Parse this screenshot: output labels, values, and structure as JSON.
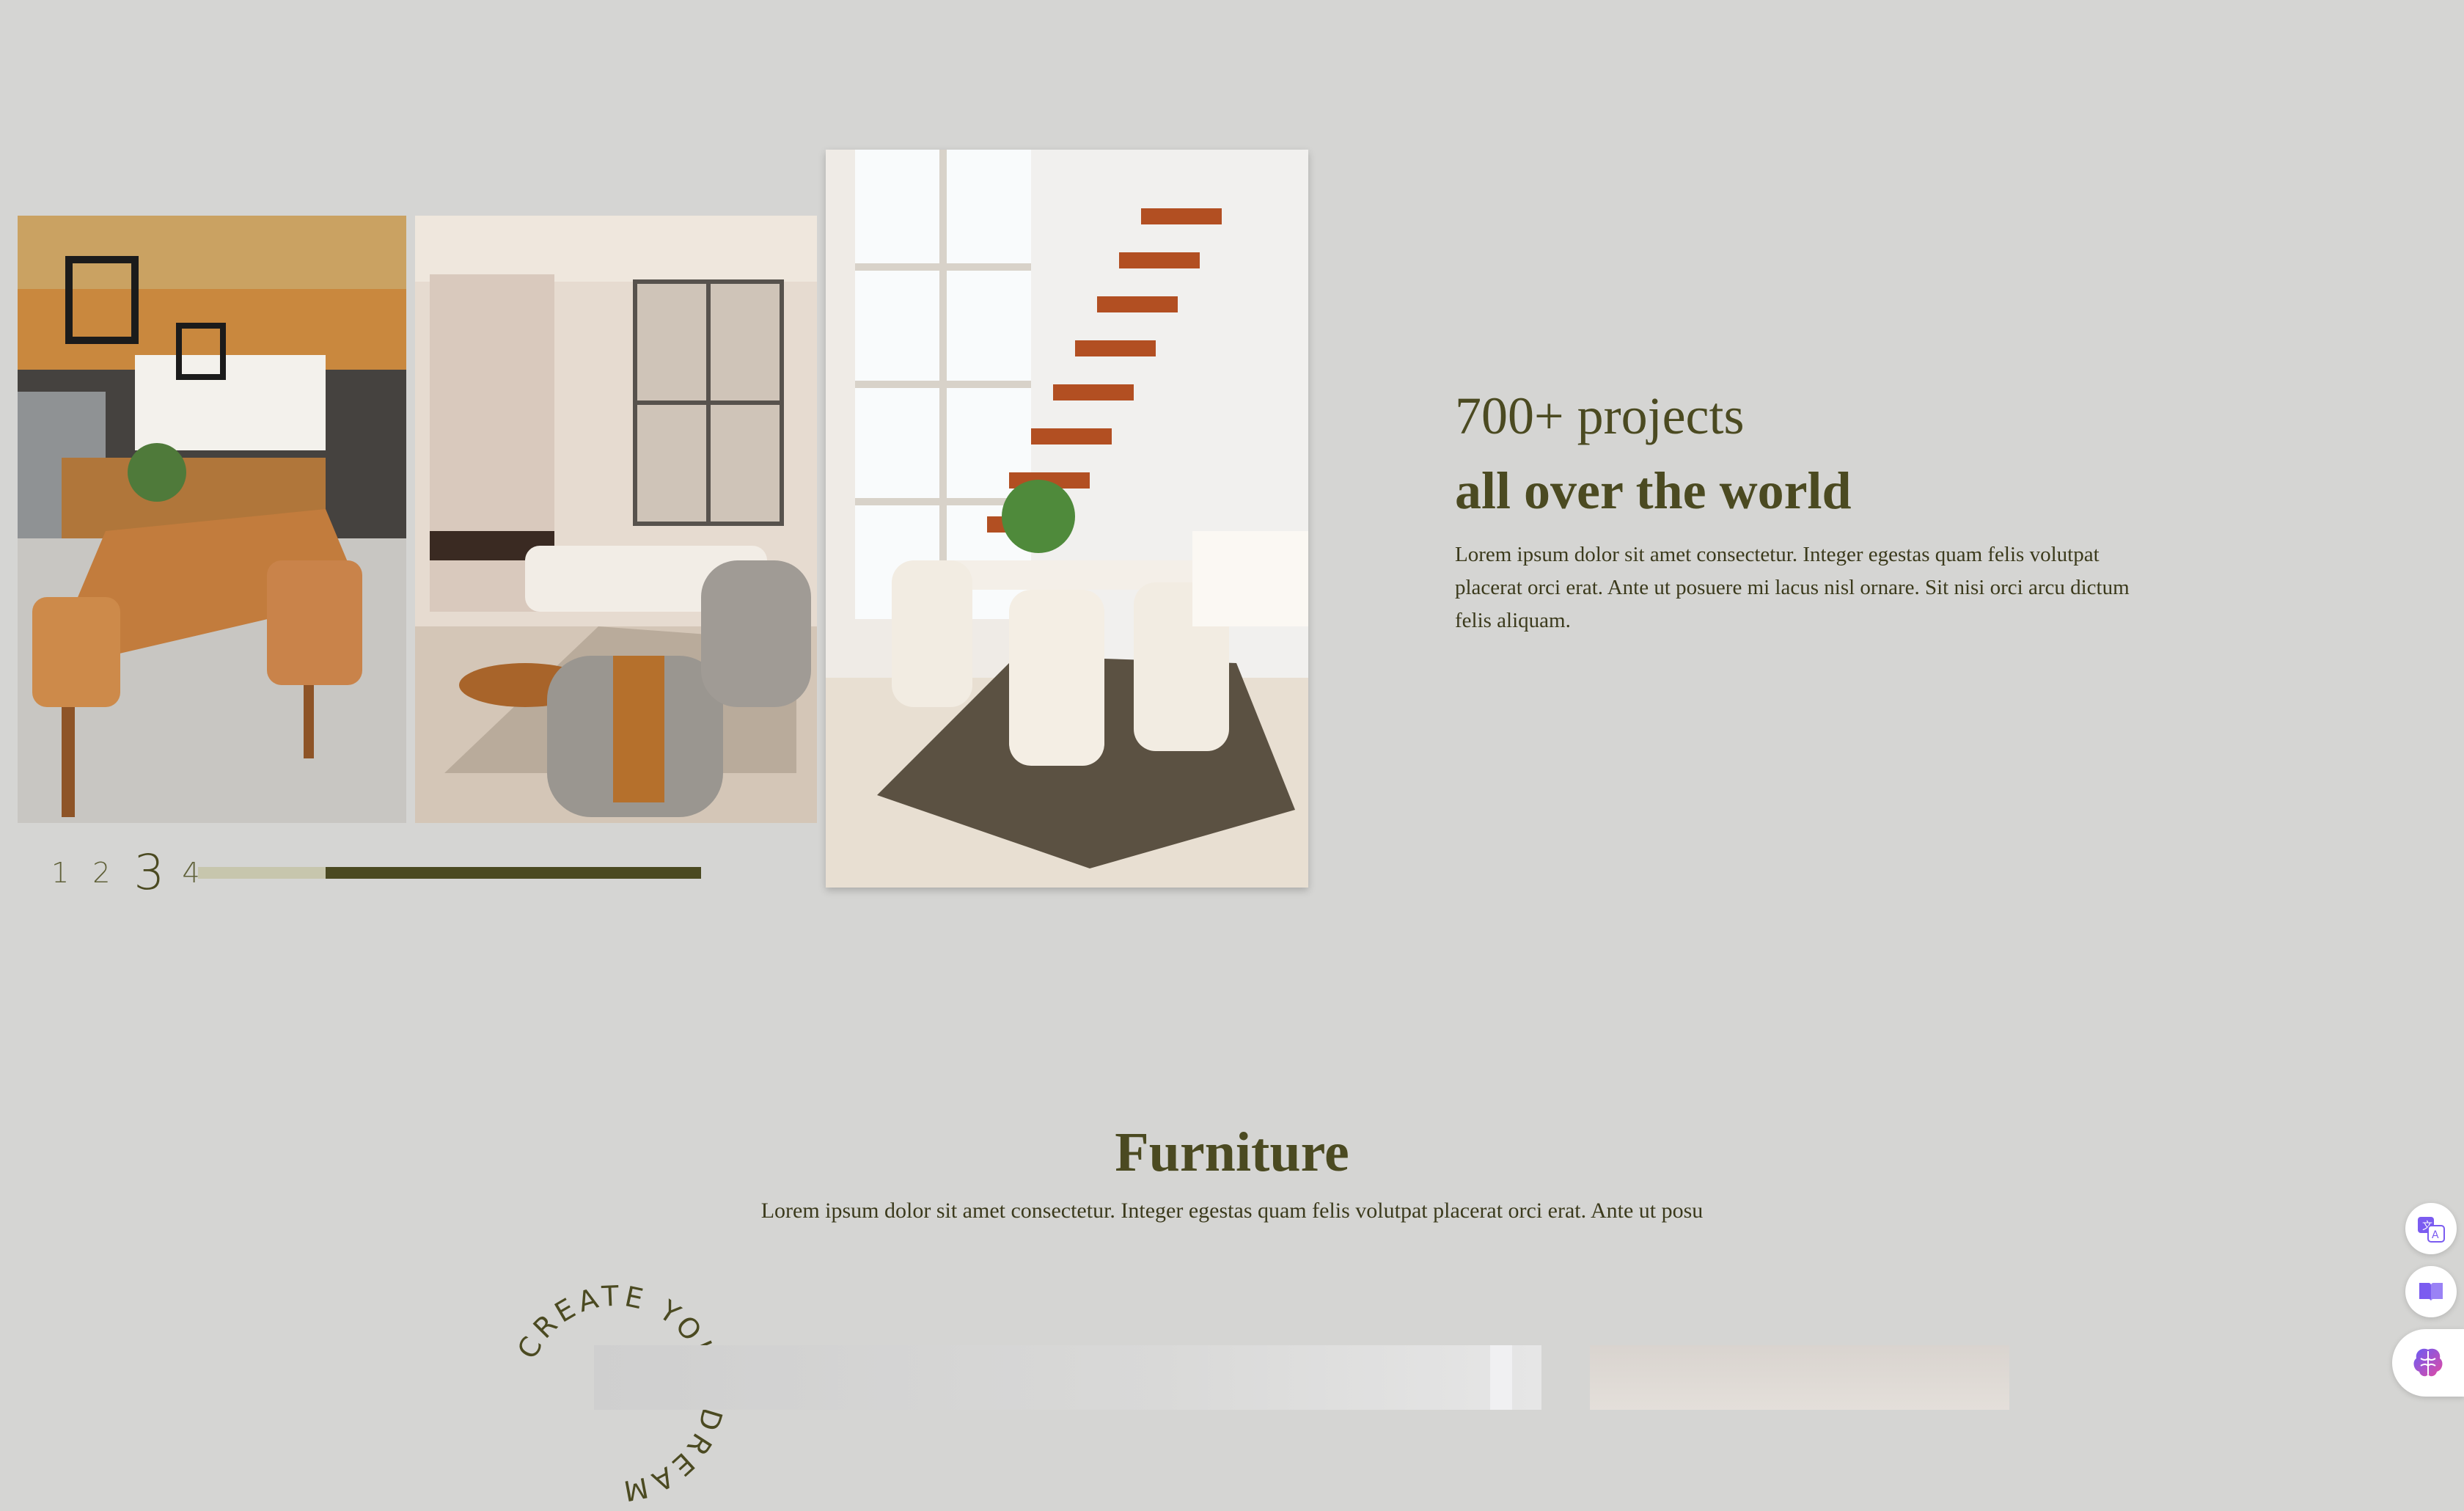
{
  "gallery": {
    "pager": {
      "pages": [
        "1",
        "2",
        "3",
        "4"
      ],
      "active_index": 2,
      "progress": 0.75
    }
  },
  "stats": {
    "line1": "700+ projects",
    "line2": "all over the world",
    "body": "Lorem ipsum dolor sit amet consectetur. Integer egestas quam felis volutpat placerat orci erat. Ante ut posuere mi lacus nisl ornare. Sit nisi orci arcu dictum felis aliquam."
  },
  "furniture": {
    "title": "Furniture",
    "subtitle": "Lorem ipsum dolor sit amet consectetur. Integer egestas quam felis volutpat placerat orci erat. Ante ut posu",
    "badge_text": "CREATE YOUR DREAM"
  },
  "floating_tools": [
    {
      "icon": "translate-icon"
    },
    {
      "icon": "book-icon"
    },
    {
      "icon": "brain-icon"
    }
  ],
  "colors": {
    "accent": "#4b4a21",
    "background": "#d5d5d3",
    "track": "#c7c6ad"
  }
}
